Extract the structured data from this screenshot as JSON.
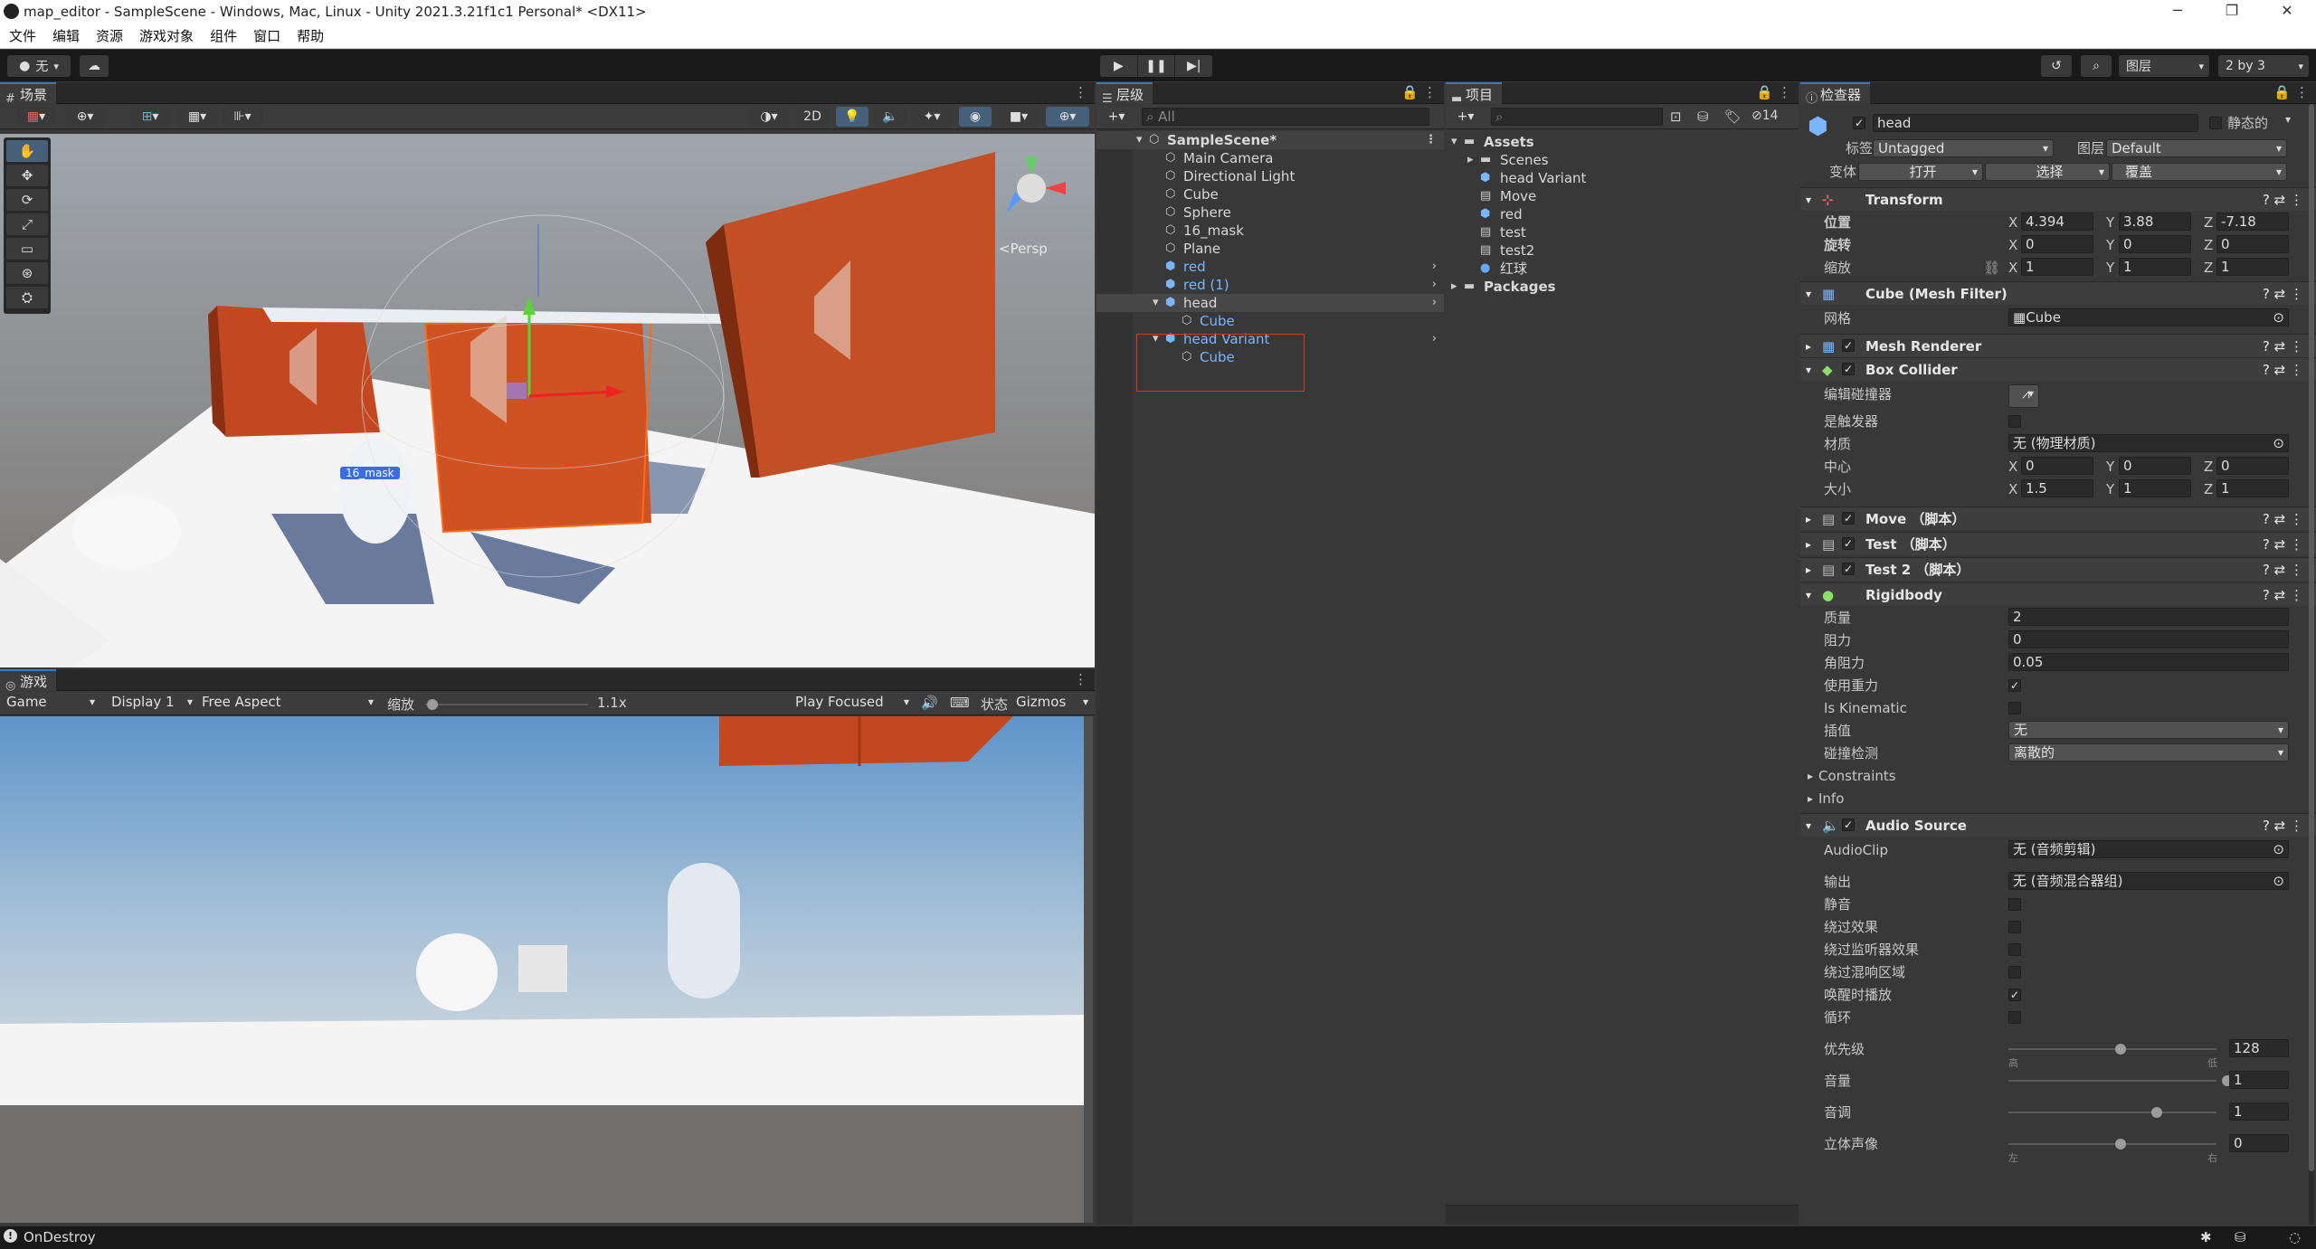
{
  "window": {
    "title": "map_editor - SampleScene - Windows, Mac, Linux - Unity 2021.3.21f1c1 Personal* <DX11>",
    "min": "─",
    "max": "❐",
    "close": "✕"
  },
  "menu": [
    "文件",
    "编辑",
    "资源",
    "游戏对象",
    "组件",
    "窗口",
    "帮助"
  ],
  "toolbar": {
    "account": "无",
    "layers": "图层",
    "layout": "2 by 3"
  },
  "scene": {
    "tab": "场景",
    "btn_2d": "2D",
    "persp": "<Persp",
    "mask_label": "16_mask"
  },
  "game": {
    "tab": "游戏",
    "mode": "Game",
    "display": "Display 1",
    "aspect": "Free Aspect",
    "scale_label": "缩放",
    "scale_value": "1.1x",
    "play_focused": "Play Focused",
    "stats": "状态",
    "gizmos": "Gizmos"
  },
  "hierarchy": {
    "tab": "层级",
    "search": "All",
    "items": [
      {
        "label": "SampleScene*"
      },
      {
        "label": "Main Camera"
      },
      {
        "label": "Directional Light"
      },
      {
        "label": "Cube"
      },
      {
        "label": "Sphere"
      },
      {
        "label": "16_mask"
      },
      {
        "label": "Plane"
      },
      {
        "label": "red"
      },
      {
        "label": "red (1)"
      },
      {
        "label": "head"
      },
      {
        "label": "Cube"
      },
      {
        "label": "head Variant"
      },
      {
        "label": "Cube"
      }
    ]
  },
  "project": {
    "tab": "项目",
    "hidden_count": "14",
    "items": [
      {
        "label": "Assets"
      },
      {
        "label": "Scenes"
      },
      {
        "label": "head Variant"
      },
      {
        "label": "Move"
      },
      {
        "label": "red"
      },
      {
        "label": "test"
      },
      {
        "label": "test2"
      },
      {
        "label": "红球"
      },
      {
        "label": "Packages"
      }
    ]
  },
  "inspector": {
    "tab": "检查器",
    "name": "head",
    "static": "静态的",
    "tag_label": "标签",
    "tag": "Untagged",
    "layer_label": "图层",
    "layer": "Default",
    "variant_label": "变体",
    "open": "打开",
    "select": "选择",
    "override": "覆盖",
    "transform": {
      "title": "Transform",
      "pos_label": "位置",
      "rot_label": "旋转",
      "scale_label": "缩放",
      "pos": [
        "4.394",
        "3.88",
        "-7.18"
      ],
      "rot": [
        "0",
        "0",
        "0"
      ],
      "scale": [
        "1",
        "1",
        "1"
      ]
    },
    "mesh_filter": {
      "title": "Cube (Mesh Filter)",
      "mesh_label": "网格",
      "mesh": "Cube"
    },
    "mesh_renderer": {
      "title": "Mesh Renderer"
    },
    "box_collider": {
      "title": "Box Collider",
      "edit_label": "编辑碰撞器",
      "trigger_label": "是触发器",
      "material_label": "材质",
      "material": "无 (物理材质)",
      "center_label": "中心",
      "center": [
        "0",
        "0",
        "0"
      ],
      "size_label": "大小",
      "size": [
        "1.5",
        "1",
        "1"
      ]
    },
    "scripts": [
      "Move （脚本）",
      "Test （脚本）",
      "Test 2 （脚本）"
    ],
    "rigidbody": {
      "title": "Rigidbody",
      "mass_label": "质量",
      "mass": "2",
      "drag_label": "阻力",
      "drag": "0",
      "angdrag_label": "角阻力",
      "angdrag": "0.05",
      "gravity_label": "使用重力",
      "kinematic_label": "Is Kinematic",
      "interp_label": "插值",
      "interp": "无",
      "collision_label": "碰撞检测",
      "collision": "离散的",
      "constraints": "Constraints",
      "info": "Info"
    },
    "audio": {
      "title": "Audio Source",
      "clip_label": "AudioClip",
      "clip": "无 (音频剪辑)",
      "output_label": "输出",
      "output": "无 (音频混合器组)",
      "mute": "静音",
      "bypass_effects": "绕过效果",
      "bypass_listener": "绕过监听器效果",
      "bypass_reverb": "绕过混响区域",
      "play_on_awake": "唤醒时播放",
      "loop": "循环",
      "priority_label": "优先级",
      "priority": "128",
      "priority_hi": "高",
      "priority_lo": "低",
      "volume_label": "音量",
      "volume": "1",
      "pitch_label": "音调",
      "pitch": "1",
      "stereo_label": "立体声像",
      "stereo": "0",
      "stereo_l": "左",
      "stereo_r": "右"
    }
  },
  "status": {
    "message": "OnDestroy"
  }
}
